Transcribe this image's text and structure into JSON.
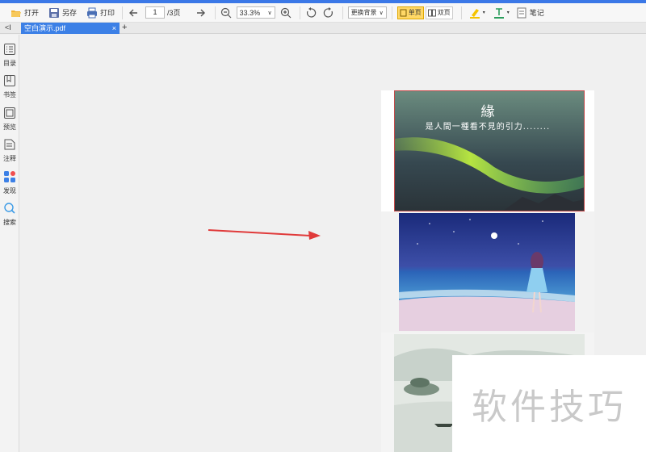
{
  "toolbar": {
    "open_label": "打开",
    "save_as_label": "另存",
    "print_label": "打印",
    "current_page": "1",
    "total_pages": "/3页",
    "zoom": "33.3%",
    "background_label": "更换背景",
    "single_page_label": "单页",
    "double_page_label": "双页",
    "note_label": "笔记"
  },
  "tabs": {
    "active_file": "空白演示.pdf",
    "close_symbol": "×",
    "add_symbol": "+"
  },
  "sidebar": {
    "collapse_symbol": "<I",
    "items": [
      {
        "label": "目录",
        "icon": "toc-icon"
      },
      {
        "label": "书签",
        "icon": "bookmark-icon"
      },
      {
        "label": "预览",
        "icon": "preview-icon"
      },
      {
        "label": "注释",
        "icon": "annotation-icon"
      },
      {
        "label": "发现",
        "icon": "discover-icon"
      },
      {
        "label": "搜索",
        "icon": "search-icon"
      }
    ]
  },
  "pages": {
    "page1_title": "緣",
    "page1_subtitle": "是人間一種看不見的引力........"
  },
  "watermark": "软件技巧",
  "colors": {
    "accent": "#3c80e6",
    "arrow": "#e03a3a",
    "active_mode": "#ffd866"
  }
}
